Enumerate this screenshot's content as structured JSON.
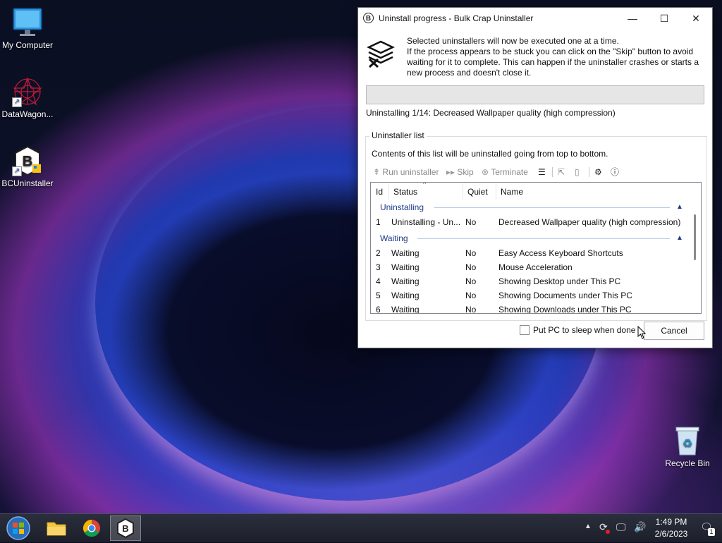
{
  "desktop": {
    "icons": [
      {
        "label": "My Computer"
      },
      {
        "label": "DataWagon..."
      },
      {
        "label": "BCUninstaller"
      },
      {
        "label": "Recycle Bin"
      }
    ]
  },
  "window": {
    "title": "Uninstall progress - Bulk Crap Uninstaller",
    "app_icon_letter": "B",
    "controls": {
      "minimize": "—",
      "maximize": "☐",
      "close": "✕"
    },
    "intro_lines": [
      "Selected uninstallers will now be executed one at a time.",
      "If the process appears to be stuck you can click on the \"Skip\" button to avoid",
      "waiting for it to complete. This can happen if the uninstaller crashes or starts a",
      "new process and doesn't close it."
    ],
    "progress": 0,
    "status_text": "Uninstalling 1/14: Decreased Wallpaper quality (high compression)",
    "groupbox_label": "Uninstaller list",
    "list_description": "Contents of this list will be uninstalled going from top to bottom.",
    "toolbar": {
      "run_label": "Run uninstaller",
      "skip_label": "Skip",
      "terminate_label": "Terminate"
    },
    "columns": {
      "id": "Id",
      "status": "Status",
      "quiet": "Quiet",
      "name": "Name"
    },
    "groups": [
      {
        "label": "Uninstalling",
        "rows": [
          {
            "id": "1",
            "status": "Uninstalling - Un...",
            "quiet": "No",
            "name": "Decreased Wallpaper quality (high compression)"
          }
        ]
      },
      {
        "label": "Waiting",
        "rows": [
          {
            "id": "2",
            "status": "Waiting",
            "quiet": "No",
            "name": "Easy Access Keyboard Shortcuts"
          },
          {
            "id": "3",
            "status": "Waiting",
            "quiet": "No",
            "name": "Mouse Acceleration"
          },
          {
            "id": "4",
            "status": "Waiting",
            "quiet": "No",
            "name": "Showing Desktop under This PC"
          },
          {
            "id": "5",
            "status": "Waiting",
            "quiet": "No",
            "name": "Showing Documents under This PC"
          },
          {
            "id": "6",
            "status": "Waiting",
            "quiet": "No",
            "name": "Showing Downloads under This PC"
          }
        ]
      }
    ],
    "sleep_checkbox_label": "Put PC to sleep when done",
    "sleep_checked": false,
    "cancel_label": "Cancel"
  },
  "taskbar": {
    "time": "1:49 PM",
    "date": "2/6/2023",
    "notification_count": "1",
    "app_letter": "B"
  },
  "colors": {
    "group_header": "#1e3a8a",
    "accent_blue": "#1a5ad8"
  }
}
